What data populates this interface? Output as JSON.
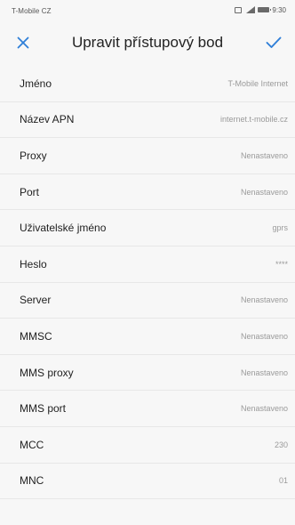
{
  "status_bar": {
    "carrier": "T-Mobile CZ",
    "time": "9:30"
  },
  "header": {
    "title": "Upravit přístupový bod",
    "close_icon": "close-icon",
    "confirm_icon": "checkmark-icon",
    "accent_color": "#2f7fd8"
  },
  "fields": [
    {
      "label": "Jméno",
      "value": "T-Mobile Internet"
    },
    {
      "label": "Název APN",
      "value": "internet.t-mobile.cz"
    },
    {
      "label": "Proxy",
      "value": "Nenastaveno"
    },
    {
      "label": "Port",
      "value": "Nenastaveno"
    },
    {
      "label": "Uživatelské jméno",
      "value": "gprs"
    },
    {
      "label": "Heslo",
      "value": "****"
    },
    {
      "label": "Server",
      "value": "Nenastaveno"
    },
    {
      "label": "MMSC",
      "value": "Nenastaveno"
    },
    {
      "label": "MMS proxy",
      "value": "Nenastaveno"
    },
    {
      "label": "MMS port",
      "value": "Nenastaveno"
    },
    {
      "label": "MCC",
      "value": "230"
    },
    {
      "label": "MNC",
      "value": "01"
    }
  ]
}
